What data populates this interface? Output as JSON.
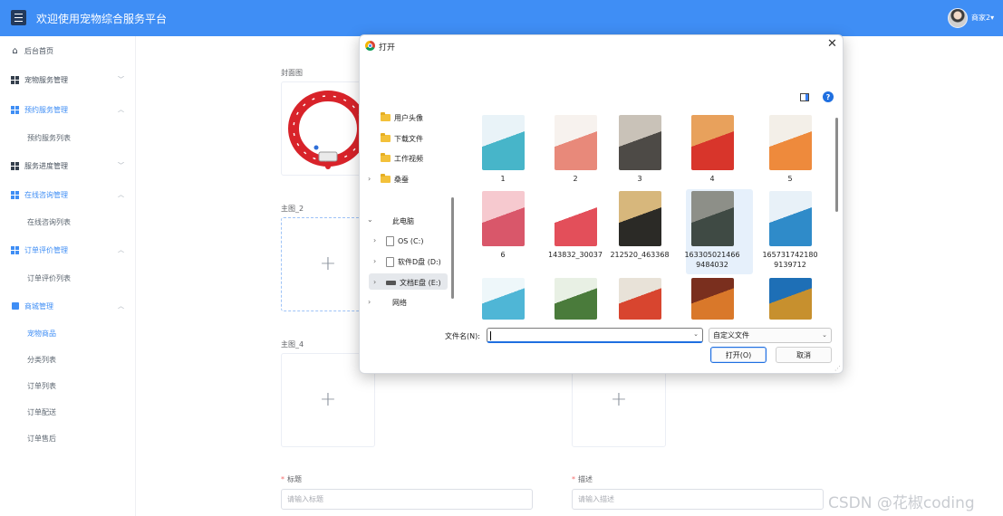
{
  "header": {
    "title": "欢迎使用宠物综合服务平台",
    "user_name": "商家2▾"
  },
  "sidebar": {
    "home": "后台首页",
    "groups": [
      {
        "label": "宠物服务管理",
        "expanded": false,
        "active": false
      },
      {
        "label": "预约服务管理",
        "expanded": true,
        "active": true,
        "children": [
          "预约服务列表"
        ]
      },
      {
        "label": "服务进度管理",
        "expanded": false,
        "active": false
      },
      {
        "label": "在线咨询管理",
        "expanded": true,
        "active": true,
        "children": [
          "在线咨询列表"
        ]
      },
      {
        "label": "订单评价管理",
        "expanded": true,
        "active": true,
        "children": [
          "订单评价列表"
        ]
      },
      {
        "label": "商城管理",
        "expanded": true,
        "active": true,
        "children": [
          "宠物商品",
          "分类列表",
          "订单列表",
          "订单配送",
          "订单售后"
        ]
      }
    ],
    "current_item": "宠物商品"
  },
  "form": {
    "cover_label": "封面图",
    "main2_label": "主图_2",
    "main4_label": "主图_4",
    "title_label": "标题",
    "title_placeholder": "请输入标题",
    "desc_label": "描述",
    "desc_placeholder": "请输入描述"
  },
  "dialog": {
    "title": "打开",
    "tree": {
      "quick": [
        "用户头像",
        "下载文件",
        "工作视频",
        "桑蚕"
      ],
      "this_pc": "此电脑",
      "drives": [
        "OS (C:)",
        "软件D盘 (D:)",
        "文档E盘 (E:)"
      ],
      "network": "网络",
      "selected": "文档E盘 (E:)"
    },
    "files": [
      {
        "name": "1",
        "colors": [
          "#e9f3f8",
          "#47b5c9"
        ]
      },
      {
        "name": "2",
        "colors": [
          "#f7f2ee",
          "#e8897a"
        ]
      },
      {
        "name": "3",
        "colors": [
          "#c9c2b8",
          "#4d4a46"
        ]
      },
      {
        "name": "4",
        "colors": [
          "#e8a15c",
          "#d8352b"
        ]
      },
      {
        "name": "5",
        "colors": [
          "#f3efe8",
          "#ee8a3c"
        ]
      },
      {
        "name": "6",
        "colors": [
          "#f6c9cf",
          "#d9576a"
        ]
      },
      {
        "name": "143832_30037",
        "colors": [
          "#ffffff",
          "#e34f5a"
        ]
      },
      {
        "name": "212520_463368",
        "colors": [
          "#d7b77c",
          "#2b2a26"
        ]
      },
      {
        "name": "1633050214669484032",
        "display": [
          "163305021466",
          "9484032"
        ],
        "colors": [
          "#8d8f88",
          "#3f4a44"
        ]
      },
      {
        "name": "1657317421809139712",
        "display": [
          "165731742180",
          "9139712"
        ],
        "colors": [
          "#e8f1f8",
          "#2f8bc9"
        ]
      },
      {
        "name": "",
        "colors": [
          "#eef7fa",
          "#4fb6d6"
        ]
      },
      {
        "name": "",
        "colors": [
          "#e8f0e4",
          "#4a7b3b"
        ]
      },
      {
        "name": "",
        "colors": [
          "#e8e2d8",
          "#d8452f"
        ]
      },
      {
        "name": "",
        "colors": [
          "#7a2f1e",
          "#d9782a"
        ]
      },
      {
        "name": "",
        "colors": [
          "#1e6fb6",
          "#c7902e"
        ]
      }
    ],
    "filename_label": "文件名(N):",
    "filename_value": "",
    "filetype": "自定义文件",
    "open_button": "打开(O)",
    "cancel_button": "取消"
  },
  "watermark": "CSDN @花椒coding",
  "colors": {
    "header_bg": "#3f8ef5",
    "accent": "#3f8ef5",
    "collar_red": "#d8232a"
  }
}
